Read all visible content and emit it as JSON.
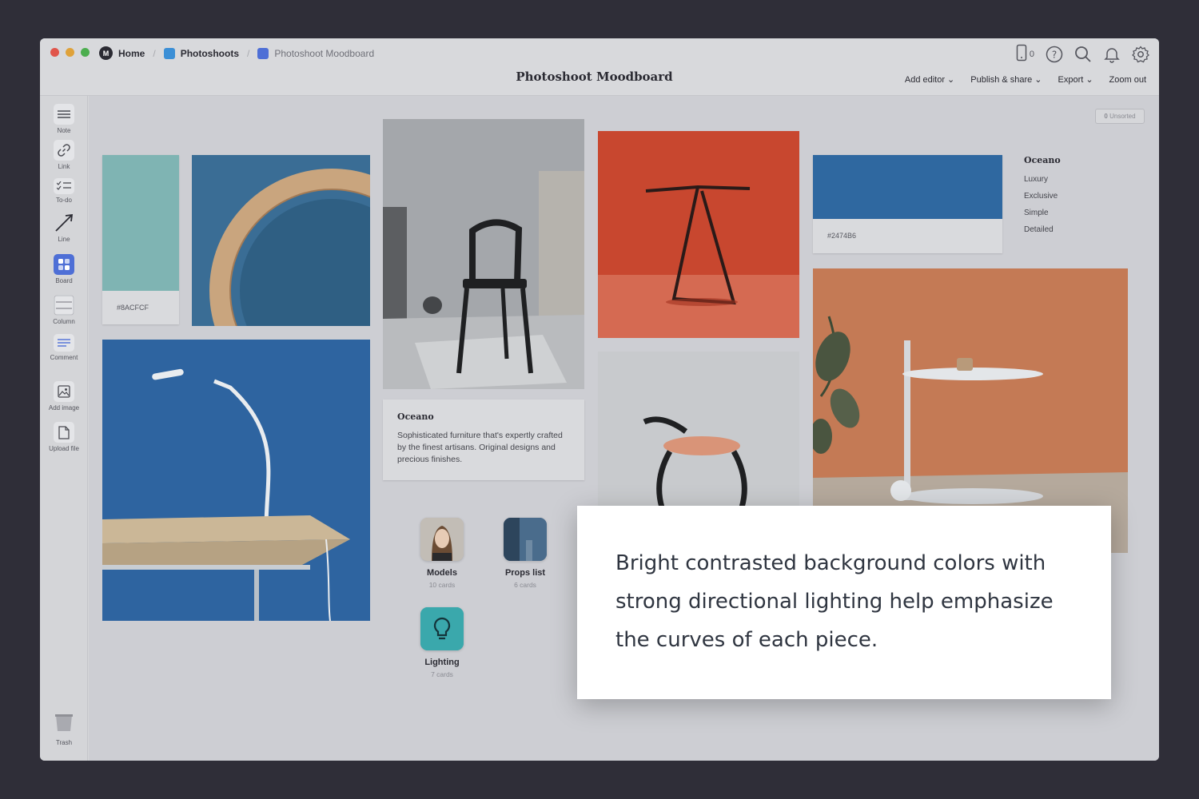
{
  "window": {
    "breadcrumb": [
      {
        "label": "Home",
        "icon": "app-logo-icon"
      },
      {
        "label": "Photoshoots",
        "icon": "board-blue-icon",
        "color": "#3b8fd6"
      },
      {
        "label": "Photoshoot Moodboard",
        "icon": "board-indigo-icon",
        "color": "#4e6fd6"
      }
    ],
    "title": "Photoshoot Moodboard",
    "device_count": "0",
    "menu": {
      "add_editor": "Add editor",
      "publish_share": "Publish & share",
      "export": "Export",
      "zoom_out": "Zoom out"
    }
  },
  "sidebar": {
    "tools": [
      "Note",
      "Link",
      "To-do",
      "Line",
      "Board",
      "Column",
      "Comment",
      "Add image",
      "Upload file"
    ],
    "trash": "Trash"
  },
  "canvas": {
    "unsorted_count": "0",
    "unsorted_label": "Unsorted",
    "swatch_1": {
      "hex": "#8ACFCF",
      "color": "#7fb4b3"
    },
    "swatch_2": {
      "hex": "#2474B6",
      "color": "#2f68a0"
    },
    "oceano_note": {
      "title": "Oceano",
      "body": "Sophisticated furniture that's expertly crafted by the finest artisans. Original designs and precious finishes."
    },
    "keywords": {
      "title": "Oceano",
      "items": [
        "Luxury",
        "Exclusive",
        "Simple",
        "Detailed"
      ]
    },
    "boards": [
      {
        "name": "Models",
        "count": "10 cards"
      },
      {
        "name": "Props list",
        "count": "6 cards"
      },
      {
        "name": "Lighting",
        "count": "7 cards"
      }
    ]
  },
  "overlay": {
    "text": "Bright contrasted background colors with strong directional lighting help emphasize the curves of each piece."
  }
}
